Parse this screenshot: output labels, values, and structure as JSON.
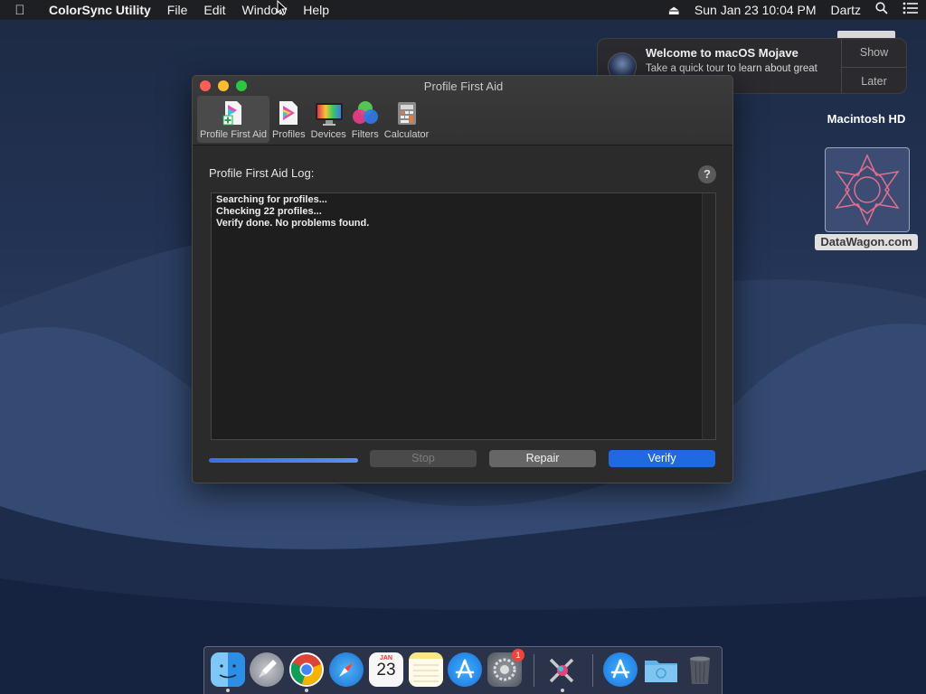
{
  "menubar": {
    "app_name": "ColorSync Utility",
    "menus": [
      "File",
      "Edit",
      "Window",
      "Help"
    ],
    "clock": "Sun Jan 23  10:04 PM",
    "user": "Dartz"
  },
  "notification": {
    "title": "Welcome to macOS Mojave",
    "text": "Take a quick tour to learn about great new features.",
    "show_label": "Show",
    "later_label": "Later"
  },
  "desktop": {
    "hd_label": "Macintosh HD",
    "site_label": "DataWagon.com"
  },
  "window": {
    "title": "Profile First Aid",
    "toolbar": [
      "Profile First Aid",
      "Profiles",
      "Devices",
      "Filters",
      "Calculator"
    ],
    "log_label": "Profile First Aid Log:",
    "help_label": "?",
    "log_lines": [
      "Searching for profiles...",
      "Checking 22 profiles...",
      "Verify done. No problems found."
    ],
    "progress": 1.0,
    "stop_label": "Stop",
    "repair_label": "Repair",
    "verify_label": "Verify"
  },
  "dock": {
    "calendar_month": "JAN",
    "calendar_day": "23",
    "badge": "1"
  },
  "colors": {
    "accent": "#1f6ae0",
    "close": "#fd5f57",
    "minimize": "#febc2e",
    "maximize": "#28c840"
  }
}
